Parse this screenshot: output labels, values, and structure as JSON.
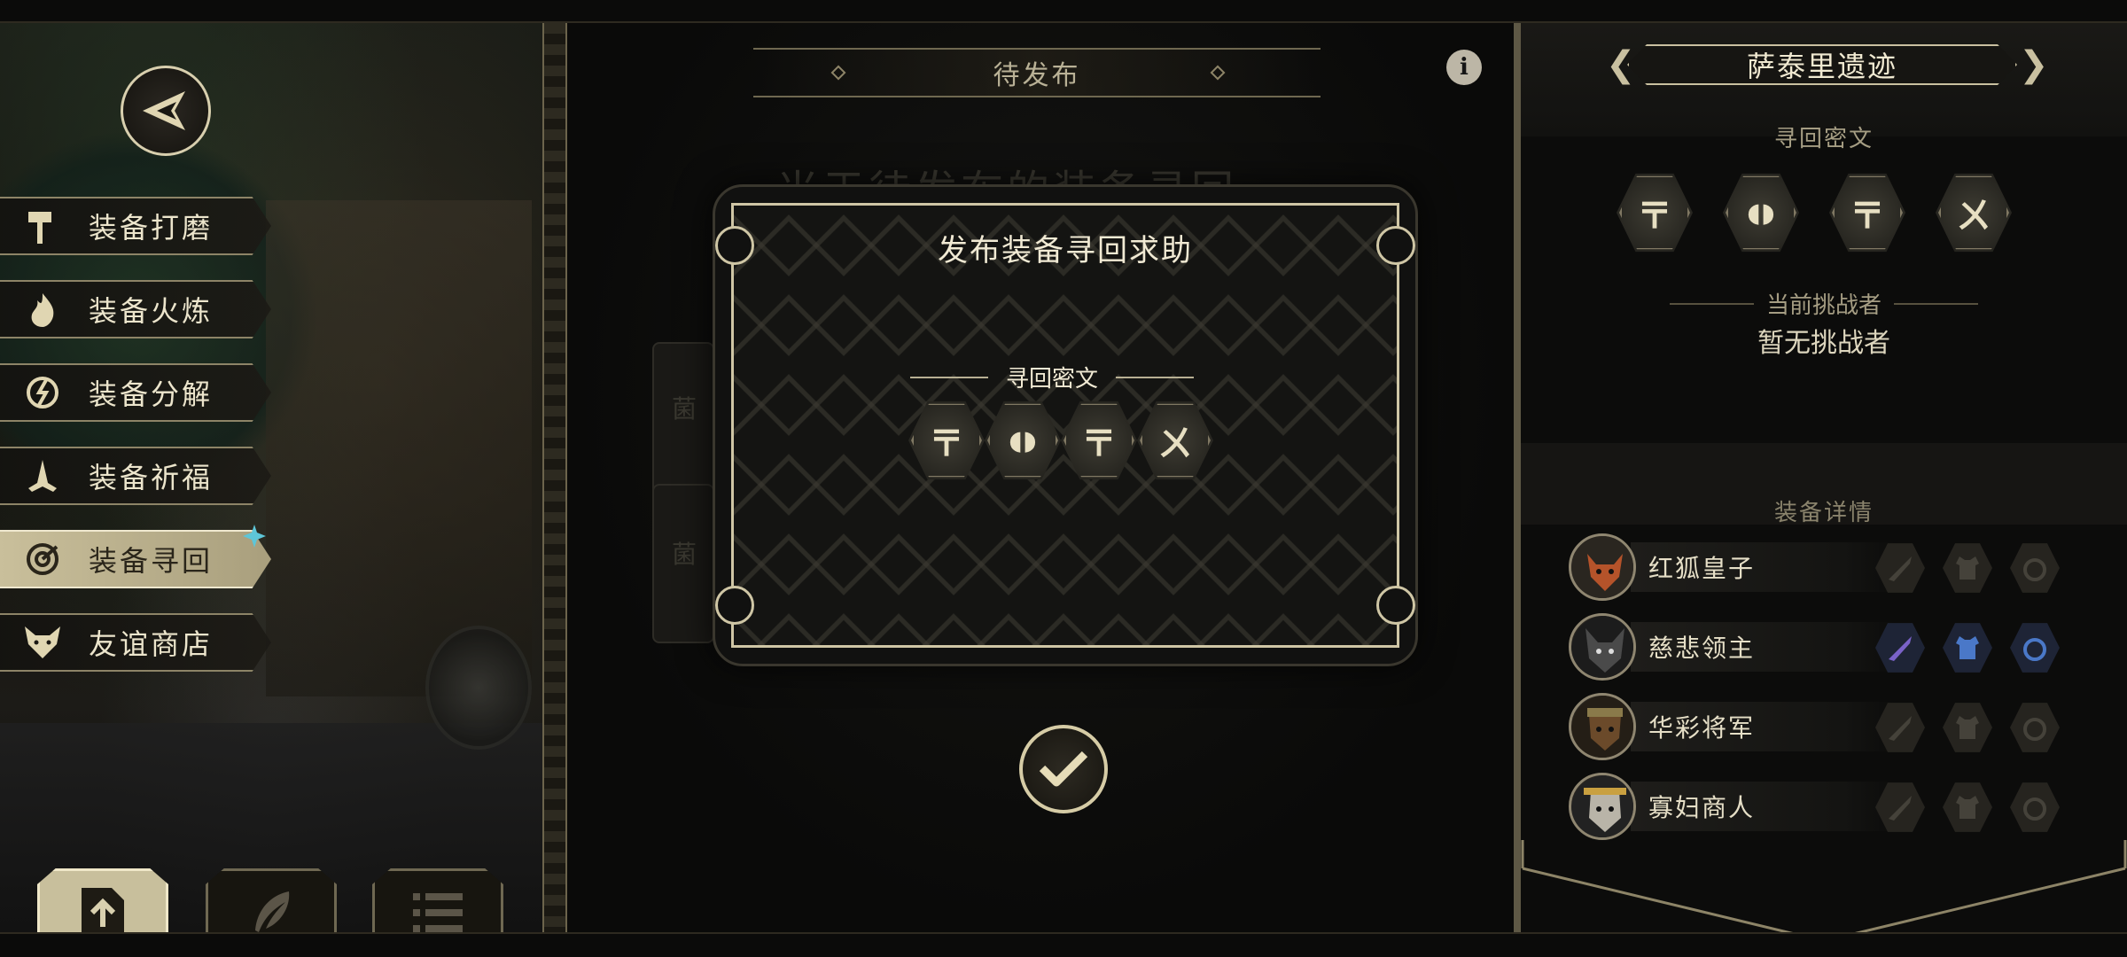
{
  "left_menu": {
    "items": [
      {
        "label": "装备打磨",
        "icon": "hammer-icon"
      },
      {
        "label": "装备火炼",
        "icon": "flame-icon"
      },
      {
        "label": "装备分解",
        "icon": "decompose-icon"
      },
      {
        "label": "装备祈福",
        "icon": "praying-hands-icon"
      },
      {
        "label": "装备寻回",
        "icon": "target-icon"
      },
      {
        "label": "友谊商店",
        "icon": "fox-icon"
      }
    ],
    "active_index": 4
  },
  "bottom_tabs": {
    "icons": [
      "upload-file-icon",
      "feather-icon",
      "list-icon"
    ],
    "active_index": 0
  },
  "center": {
    "title": "待发布",
    "bg_heading": "当于待发布的装备寻回",
    "bg_card_chars": [
      "菌",
      "菌"
    ]
  },
  "modal": {
    "title": "发布装备寻回求助",
    "subtitle": "寻回密文",
    "cipher": [
      "〒",
      "◖◗",
      "〒",
      "ㄨ"
    ]
  },
  "right_panel": {
    "location": "萨泰里遗迹",
    "cipher_label": "寻回密文",
    "cipher": [
      "〒",
      "◖◗",
      "〒",
      "ㄨ"
    ],
    "challenger_label": "当前挑战者",
    "challenger_value": "暂无挑战者",
    "equip_label": "装备详情",
    "equipment": [
      {
        "name": "红狐皇子",
        "slots_filled": [
          false,
          false,
          false
        ],
        "avatar_color": "#b5532a"
      },
      {
        "name": "慈悲领主",
        "slots_filled": [
          true,
          true,
          true
        ],
        "avatar_color": "#3a3a3a"
      },
      {
        "name": "华彩将军",
        "slots_filled": [
          false,
          false,
          false
        ],
        "avatar_color": "#6b4a2a"
      },
      {
        "name": "寡妇商人",
        "slots_filled": [
          false,
          false,
          false
        ],
        "avatar_color": "#5a5650"
      }
    ]
  },
  "colors": {
    "gold": "#cfc6a5",
    "active_tab": "#c8bf9c",
    "filled_slot_blue": "#4a78c8",
    "filled_slot_purple": "#7a62c8"
  }
}
